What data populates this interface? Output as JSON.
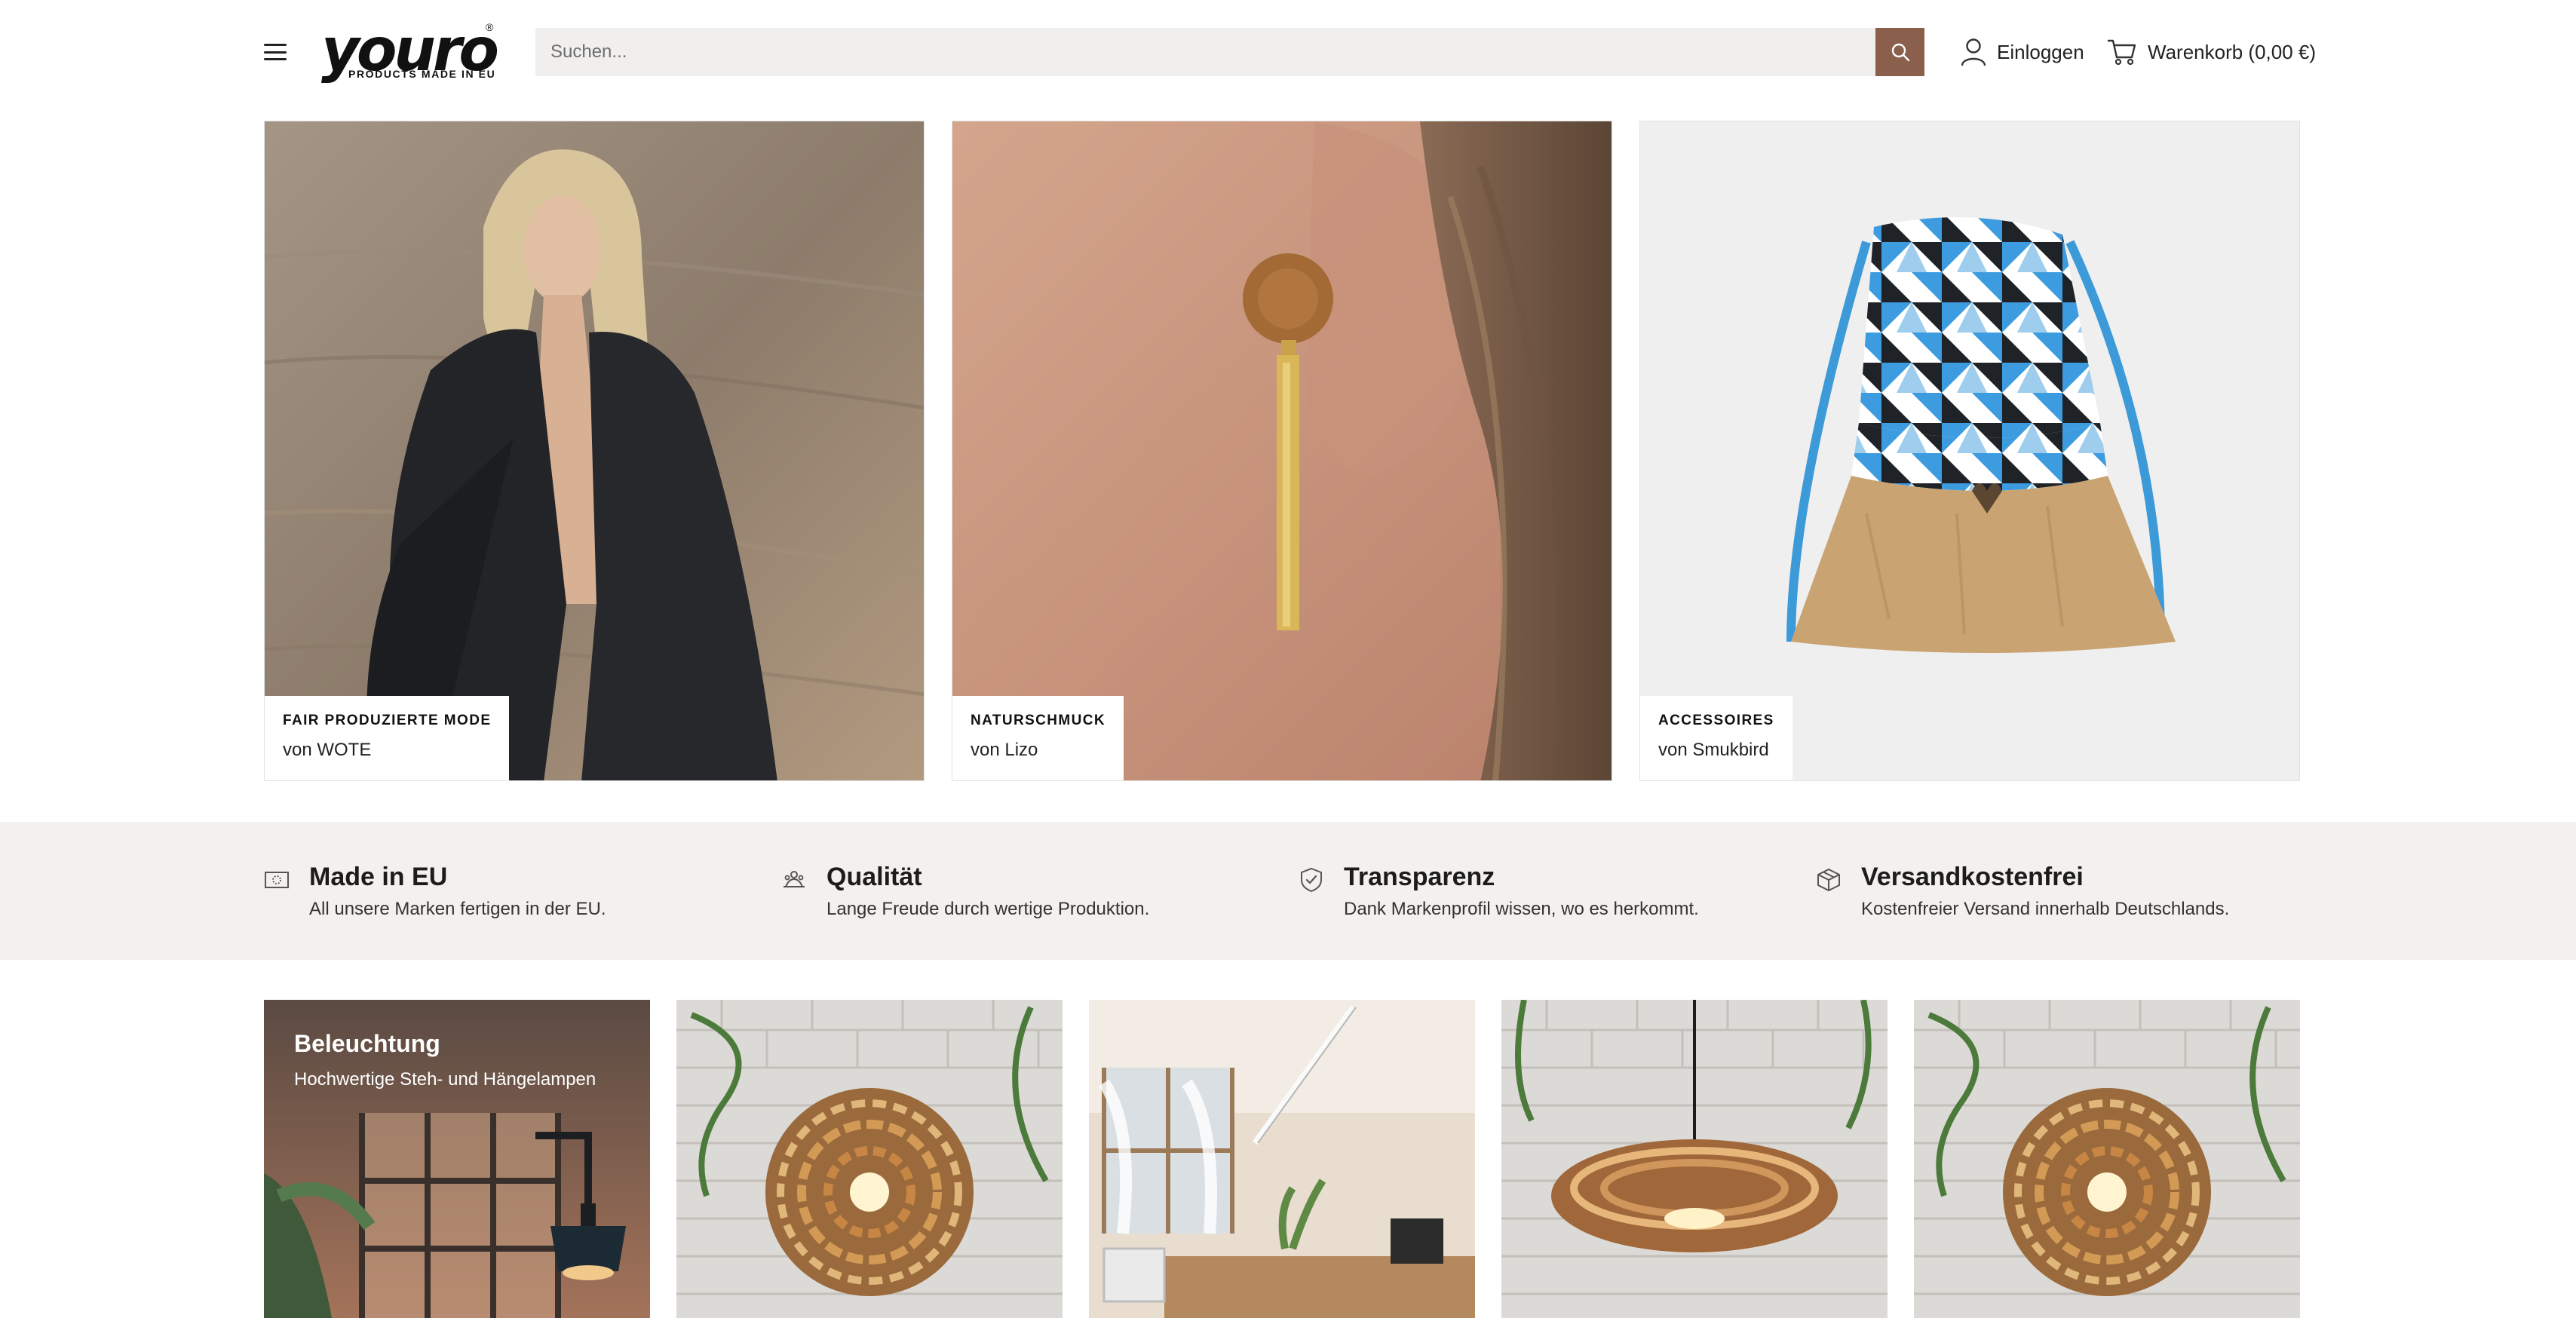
{
  "header": {
    "logo_text": "youro",
    "logo_sub": "PRODUCTS MADE IN EU",
    "logo_reg": "®",
    "search_placeholder": "Suchen...",
    "login_label": "Einloggen",
    "cart_label": "Warenkorb (0,00 €)",
    "accent_color": "#8a5f4c"
  },
  "hero": [
    {
      "category": "FAIR PRODUZIERTE MODE",
      "brand": "von WOTE"
    },
    {
      "category": "NATURSCHMUCK",
      "brand": "von Lizo"
    },
    {
      "category": "ACCESSOIRES",
      "brand": "von Smukbird"
    }
  ],
  "usps": [
    {
      "icon": "eu-flag-icon",
      "title": "Made in EU",
      "text": "All unsere Marken fertigen in der EU."
    },
    {
      "icon": "quality-icon",
      "title": "Qualität",
      "text": "Lange Freude durch wertige Produktion."
    },
    {
      "icon": "shield-check-icon",
      "title": "Transparenz",
      "text": "Dank Markenprofil wissen, wo es herkommt."
    },
    {
      "icon": "package-icon",
      "title": "Versandkostenfrei",
      "text": "Kostenfreier Versand innerhalb Deutschlands."
    }
  ],
  "category_tile": {
    "title": "Beleuchtung",
    "subtitle": "Hochwertige Steh- und Hängelampen"
  }
}
